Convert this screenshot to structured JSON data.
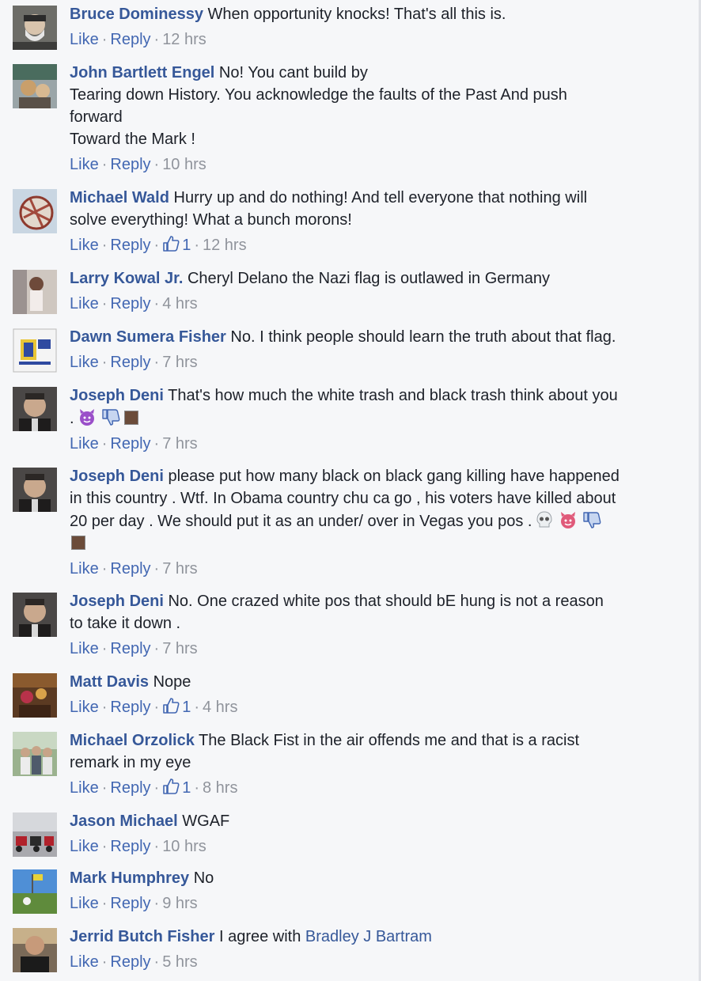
{
  "comments": [
    {
      "name": "Bruce Dominessy",
      "text": "When opportunity knocks! That's all this is.",
      "like": "Like",
      "reply": "Reply",
      "time": "12 hrs"
    },
    {
      "name": "John Bartlett Engel",
      "line1": "No! You cant build by",
      "line2": "Tearing down History. You acknowledge the faults of the Past And push",
      "line3": "forward",
      "line4": "Toward the Mark !",
      "like": "Like",
      "reply": "Reply",
      "time": "10 hrs"
    },
    {
      "name": "Michael Wald",
      "line1": "Hurry up and do nothing! And tell everyone that nothing will",
      "line2": "solve everything! What a bunch morons!",
      "like": "Like",
      "reply": "Reply",
      "likes": "1",
      "time": "12 hrs"
    },
    {
      "name": "Larry Kowal Jr.",
      "text": "Cheryl Delano the Nazi flag is outlawed in Germany",
      "like": "Like",
      "reply": "Reply",
      "time": "4 hrs"
    },
    {
      "name": "Dawn Sumera Fisher",
      "text": "No. I think people should learn the truth about that flag.",
      "like": "Like",
      "reply": "Reply",
      "time": "7 hrs"
    },
    {
      "name": "Joseph Deni",
      "line1": "That's how much the white trash and black trash think about you",
      "line2": ".",
      "like": "Like",
      "reply": "Reply",
      "time": "7 hrs"
    },
    {
      "name": "Joseph Deni",
      "line1": "please put how many black on black gang killing have happened",
      "line2": "in this country . Wtf. In Obama country chu ca go , his voters have killed about",
      "line3": "20 per day . We should put it as an under/ over in Vegas you pos .",
      "like": "Like",
      "reply": "Reply",
      "time": "7 hrs"
    },
    {
      "name": "Joseph Deni",
      "line1": "No. One crazed white pos that should bE hung is not a reason",
      "line2": "to take it down .",
      "like": "Like",
      "reply": "Reply",
      "time": "7 hrs"
    },
    {
      "name": "Matt Davis",
      "text": "Nope",
      "like": "Like",
      "reply": "Reply",
      "likes": "1",
      "time": "4 hrs"
    },
    {
      "name": "Michael Orzolick",
      "line1": "The Black Fist in the air offends me and that is a racist",
      "line2": "remark in my eye",
      "like": "Like",
      "reply": "Reply",
      "likes": "1",
      "time": "8 hrs"
    },
    {
      "name": "Jason Michael",
      "text": "WGAF",
      "like": "Like",
      "reply": "Reply",
      "time": "10 hrs"
    },
    {
      "name": "Mark Humphrey",
      "text": "No",
      "like": "Like",
      "reply": "Reply",
      "time": "9 hrs"
    },
    {
      "name": "Jerrid Butch Fisher",
      "text": "I agree with",
      "mention": "Bradley J Bartram",
      "like": "Like",
      "reply": "Reply",
      "time": "5 hrs"
    }
  ],
  "colors": {
    "link": "#365899",
    "action": "#4267b2",
    "meta": "#90949c",
    "text": "#1d2129",
    "background": "#f6f7f9"
  },
  "icons": [
    "thumbs-up-icon",
    "devil-emoji-icon",
    "thumbs-down-icon",
    "skull-emoji-icon"
  ]
}
